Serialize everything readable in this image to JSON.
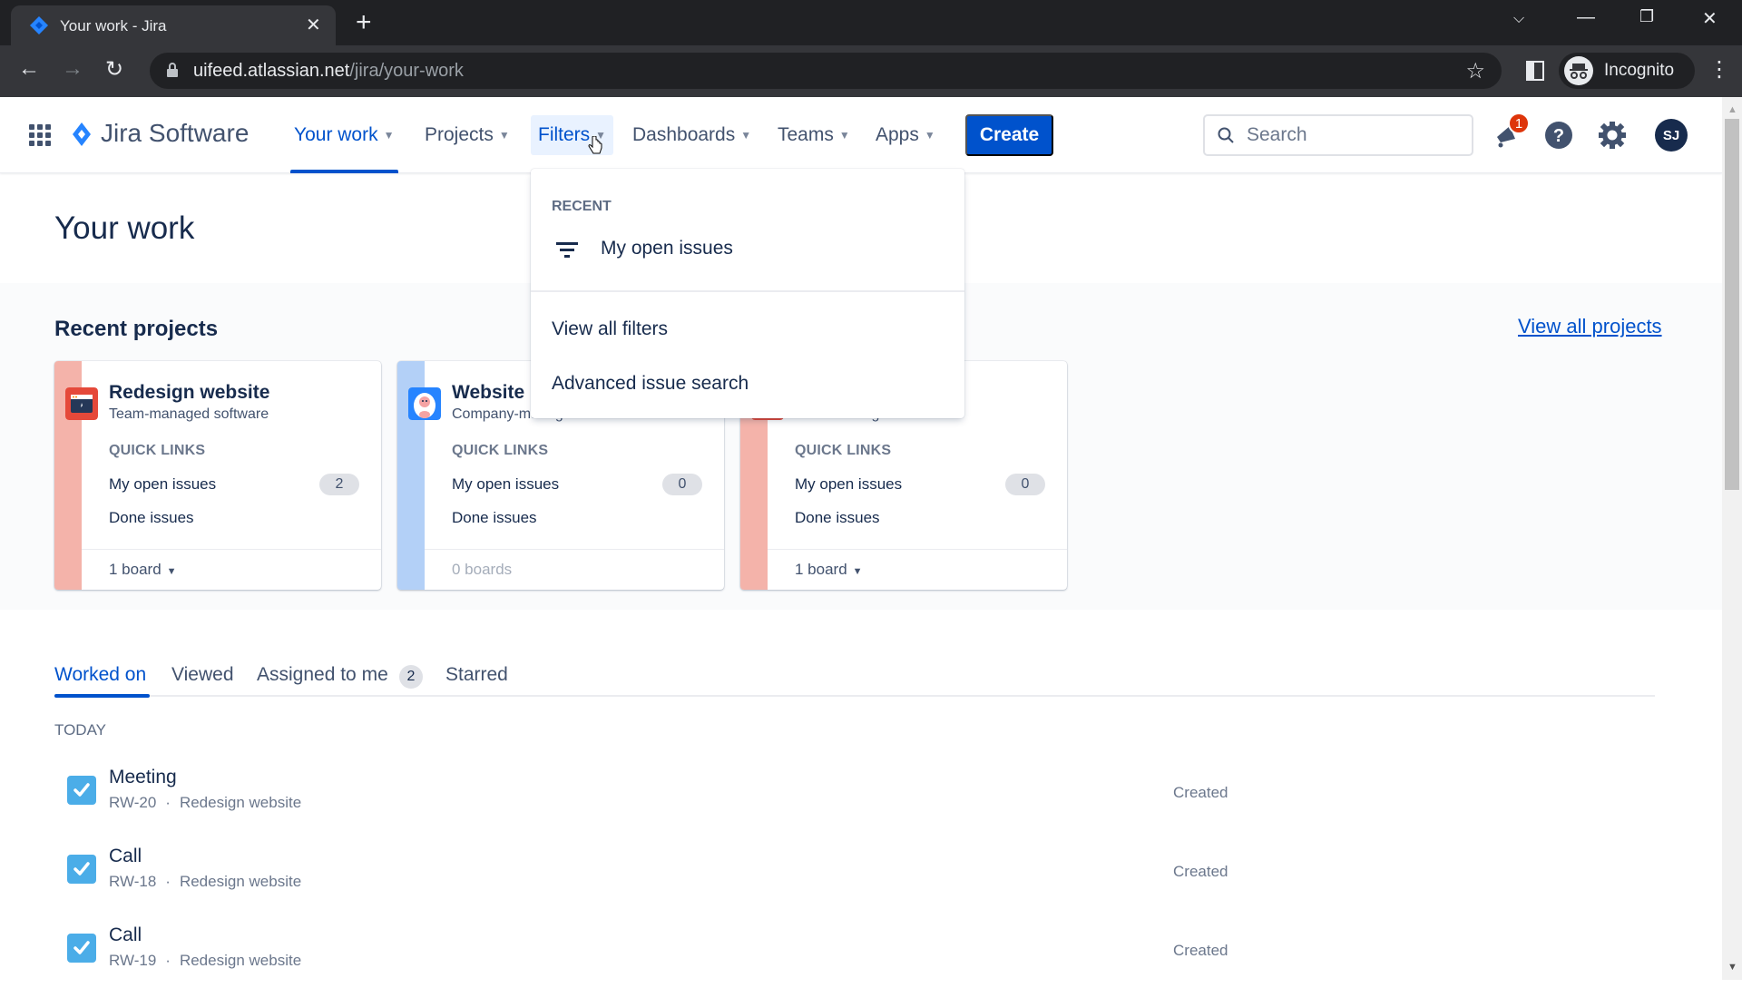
{
  "browser": {
    "tab_title": "Your work - Jira",
    "url_host": "uifeed.atlassian.net",
    "url_path": "/jira/your-work",
    "profile_label": "Incognito"
  },
  "header": {
    "product_name": "Jira Software",
    "nav": [
      {
        "label": "Your work",
        "state": "active"
      },
      {
        "label": "Projects"
      },
      {
        "label": "Filters",
        "state": "open"
      },
      {
        "label": "Dashboards"
      },
      {
        "label": "Teams"
      },
      {
        "label": "Apps"
      }
    ],
    "create_label": "Create",
    "search_placeholder": "Search",
    "notification_count": "1",
    "avatar_initials": "SJ",
    "accent_color": "#0052cc"
  },
  "filters_menu": {
    "section_label": "RECENT",
    "recent_items": [
      {
        "label": "My open issues",
        "icon": "filter-icon"
      }
    ],
    "items": [
      {
        "label": "View all filters"
      },
      {
        "label": "Advanced issue search"
      }
    ]
  },
  "page": {
    "title": "Your work",
    "recent_projects_title": "Recent projects",
    "view_all_projects": "View all projects"
  },
  "projects": [
    {
      "name": "Redesign website",
      "type": "Team-managed software",
      "quick_links_label": "QUICK LINKS",
      "open_issues_label": "My open issues",
      "open_issues_count": "2",
      "done_issues_label": "Done issues",
      "boards_label": "1 board",
      "stripe_color": "#f4b3aa",
      "icon_color": "#e5493a"
    },
    {
      "name": "Website r",
      "type": "Company-managed software",
      "quick_links_label": "QUICK LINKS",
      "open_issues_label": "My open issues",
      "open_issues_count": "0",
      "done_issues_label": "Done issues",
      "boards_label": "0 boards",
      "stripe_color": "#b3d0f7",
      "icon_color": "#2684ff"
    },
    {
      "name": "",
      "type": "Team-managed business",
      "quick_links_label": "QUICK LINKS",
      "open_issues_label": "My open issues",
      "open_issues_count": "0",
      "done_issues_label": "Done issues",
      "boards_label": "1 board",
      "stripe_color": "#f4b3aa",
      "icon_color": "#e5493a"
    }
  ],
  "work_tabs": [
    {
      "label": "Worked on",
      "active": true
    },
    {
      "label": "Viewed"
    },
    {
      "label": "Assigned to me",
      "count": "2"
    },
    {
      "label": "Starred"
    }
  ],
  "worked_on": {
    "group_label": "TODAY",
    "items": [
      {
        "title": "Meeting",
        "key": "RW-20",
        "project": "Redesign website",
        "status": "Created"
      },
      {
        "title": "Call",
        "key": "RW-18",
        "project": "Redesign website",
        "status": "Created"
      },
      {
        "title": "Call",
        "key": "RW-19",
        "project": "Redesign website",
        "status": "Created"
      }
    ],
    "separator": "·"
  }
}
